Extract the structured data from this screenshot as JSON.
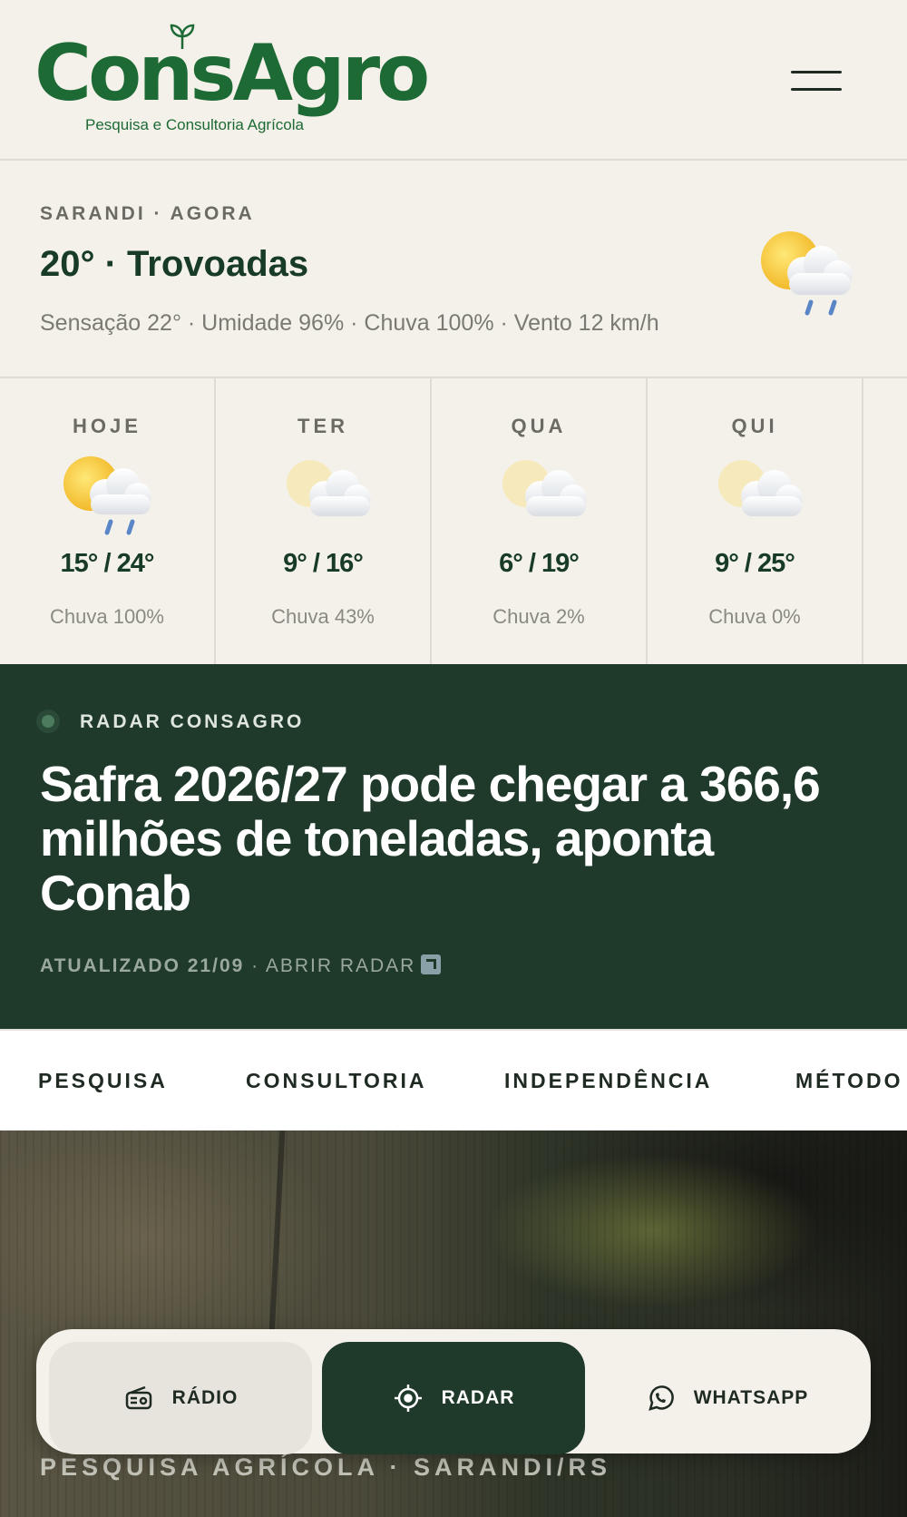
{
  "header": {
    "logo_word": "ConsAgro",
    "logo_tagline": "Pesquisa e Consultoria Agrícola",
    "menu_icon": "hamburger-menu-icon"
  },
  "current": {
    "location": "SARANDI · AGORA",
    "headline": "20° · Trovoadas",
    "details": "Sensação 22° · Umidade 96% · Chuva 100% · Vento 12 km/h",
    "icon": "sun-cloud-rain-icon"
  },
  "forecast": [
    {
      "day": "HOJE",
      "temp": "15° / 24°",
      "rain": "Chuva 100%",
      "icon": "sun-cloud-rain-icon"
    },
    {
      "day": "TER",
      "temp": "9° / 16°",
      "rain": "Chuva 43%",
      "icon": "sun-cloud-icon"
    },
    {
      "day": "QUA",
      "temp": "6° / 19°",
      "rain": "Chuva 2%",
      "icon": "sun-cloud-icon"
    },
    {
      "day": "QUI",
      "temp": "9° / 25°",
      "rain": "Chuva 0%",
      "icon": "sun-cloud-icon"
    }
  ],
  "radar": {
    "label": "RADAR CONSAGRO",
    "title": "Safra 2026/27 pode chegar a 366,6 milhões de toneladas, aponta Conab",
    "updated": "ATUALIZADO 21/09",
    "separator": " · ",
    "link": "ABRIR RADAR"
  },
  "nav": {
    "items": [
      "PESQUISA",
      "CONSULTORIA",
      "INDEPENDÊNCIA",
      "MÉTODO"
    ]
  },
  "hero": {
    "caption": "PESQUISA AGRÍCOLA · SARANDI/RS"
  },
  "bottombar": {
    "radio": "RÁDIO",
    "radar": "RADAR",
    "whatsapp": "WHATSAPP"
  },
  "colors": {
    "brand_green": "#1d6a35",
    "dark_green": "#1f3a2b",
    "background": "#f3f1ea"
  }
}
